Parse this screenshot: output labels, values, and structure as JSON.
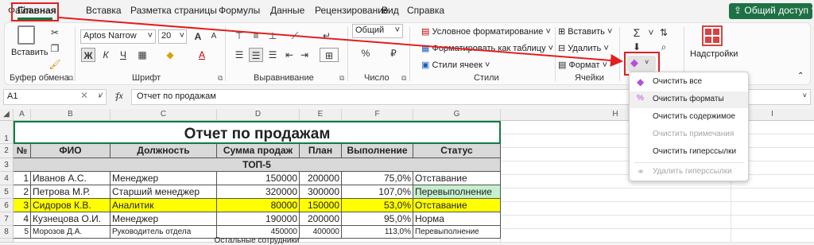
{
  "menu": {
    "tabs": [
      "Файл",
      "Главная",
      "Вставка",
      "Разметка страницы",
      "Формулы",
      "Данные",
      "Рецензирование",
      "Вид",
      "Справка"
    ],
    "share_label": "Общий доступ"
  },
  "ribbon": {
    "clipboard": {
      "paste": "Вставить",
      "label": "Буфер обмена"
    },
    "font": {
      "name": "Aptos Narrow",
      "size": "20",
      "label": "Шрифт",
      "bold": "Ж",
      "italic": "К",
      "underline": "Ч",
      "grow": "A",
      "shrink": "A"
    },
    "alignment": {
      "label": "Выравнивание"
    },
    "number": {
      "format": "Общий",
      "label": "Число"
    },
    "styles": {
      "conditional": "Условное форматирование",
      "as_table": "Форматировать как таблицу",
      "cell_styles": "Стили ячеек",
      "label": "Стили"
    },
    "cells": {
      "insert": "Вставить",
      "delete": "Удалить",
      "format": "Формат",
      "label": "Ячейки"
    },
    "addins": {
      "label": "Надстройки"
    }
  },
  "formula_bar": {
    "name_box": "A1",
    "fx": "fx",
    "content": "Отчет по продажам"
  },
  "columns": [
    "A",
    "B",
    "C",
    "D",
    "E",
    "F",
    "G",
    "H",
    "I"
  ],
  "rows": [
    "1",
    "2",
    "3",
    "4",
    "5",
    "6",
    "7",
    "8"
  ],
  "sheet": {
    "title": "Отчет по продажам",
    "headers": [
      "№",
      "ФИО",
      "Должность",
      "Сумма продаж",
      "План",
      "Выполнение",
      "Статус"
    ],
    "group1": "ТОП-5",
    "data": [
      [
        "1",
        "Иванов А.С.",
        "Менеджер",
        "150000",
        "200000",
        "75,0%",
        "Отставание"
      ],
      [
        "2",
        "Петрова М.Р.",
        "Старший менеджер",
        "320000",
        "300000",
        "107,0%",
        "Перевыполнение"
      ],
      [
        "3",
        "Сидоров К.В.",
        "Аналитик",
        "80000",
        "150000",
        "53,0%",
        "Отставание"
      ],
      [
        "4",
        "Кузнецова О.И.",
        "Менеджер",
        "190000",
        "200000",
        "95,0%",
        "Норма"
      ],
      [
        "5",
        "Морозов Д.А.",
        "Руководитель отдела",
        "450000",
        "400000",
        "113,0%",
        "Перевыполнение"
      ]
    ],
    "group2": "Остальные сотрудники"
  },
  "dropdown": {
    "items": [
      {
        "label": "Очистить все",
        "icon": "eraser-icon",
        "enabled": true
      },
      {
        "label": "Очистить форматы",
        "icon": "clear-formats-icon",
        "enabled": true
      },
      {
        "label": "Очистить содержимое",
        "icon": "",
        "enabled": true
      },
      {
        "label": "Очистить примечания",
        "icon": "",
        "enabled": false
      },
      {
        "label": "Очистить гиперссылки",
        "icon": "",
        "enabled": true
      },
      {
        "label": "Удалить гиперссылки",
        "icon": "unlink-icon",
        "enabled": false
      }
    ]
  },
  "colors": {
    "accent": "#107c41",
    "highlight": "#e0201f",
    "yellow": "#ffff00",
    "green_fill": "#c6efce"
  }
}
